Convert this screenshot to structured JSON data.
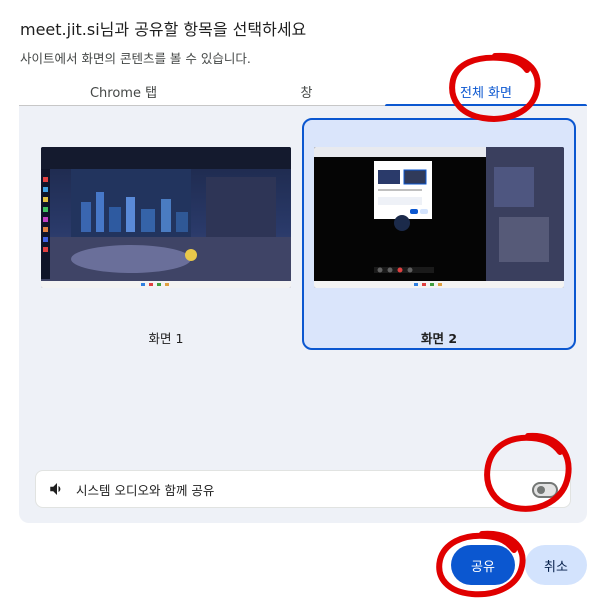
{
  "dialog": {
    "title": "meet.jit.si님과 공유할 항목을 선택하세요",
    "subtitle": "사이트에서 화면의 콘텐츠를 볼 수 있습니다."
  },
  "tabs": [
    {
      "label": "Chrome 탭",
      "selected": false
    },
    {
      "label": "창",
      "selected": false
    },
    {
      "label": "전체 화면",
      "selected": true
    }
  ],
  "screens": [
    {
      "label": "화면 1",
      "selected": false
    },
    {
      "label": "화면 2",
      "selected": true
    }
  ],
  "audio": {
    "label": "시스템 오디오와 함께 공유",
    "enabled": false,
    "icon": "speaker-icon"
  },
  "buttons": {
    "share": "공유",
    "cancel": "취소"
  },
  "colors": {
    "accent": "#0b57d0",
    "selected_card_bg": "#dae5fb",
    "panel_bg": "#eef1f7",
    "annotation": "#e00000"
  }
}
